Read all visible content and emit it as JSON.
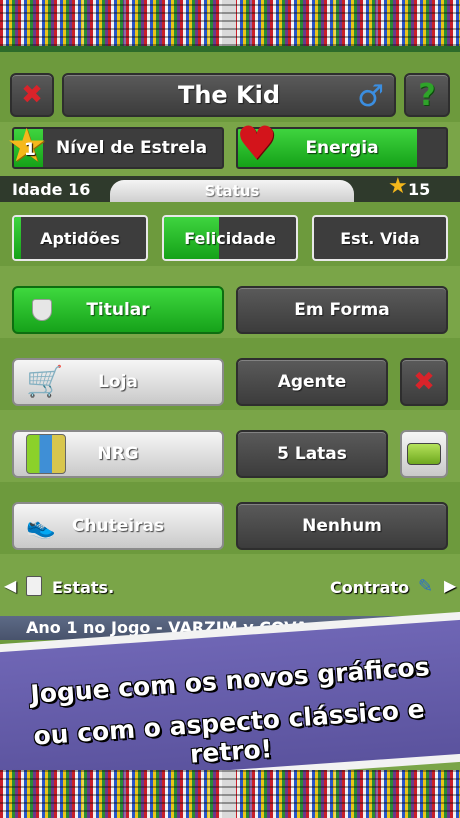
{
  "header": {
    "player_name": "The Kid",
    "close_icon": "close-x-icon",
    "gender_icon": "male-symbol-icon",
    "help_label": "?"
  },
  "bars": {
    "star_level": "1",
    "star_label": "Nível de Estrela",
    "star_fill": 0.14,
    "energy_label": "Energia",
    "energy_fill": 0.86
  },
  "status": {
    "age_label": "Idade 16",
    "tab_label": "Status",
    "coins": "15"
  },
  "attributes": {
    "aptidoes_label": "Aptidões",
    "aptidoes_fill": 0.05,
    "felicidade_label": "Felicidade",
    "felicidade_fill": 0.42,
    "estvida_label": "Est. Vida",
    "estvida_fill": 0.0
  },
  "actions": {
    "titular": "Titular",
    "em_forma": "Em Forma",
    "loja": "Loja",
    "agente": "Agente",
    "nrg": "NRG",
    "latas": "5 Latas",
    "chuteiras": "Chuteiras",
    "nenhum": "Nenhum"
  },
  "nav": {
    "stats": "Estats.",
    "contract": "Contrato",
    "ticker": "Ano 1    no Jogo - VARZIM v COVA"
  },
  "promo": {
    "line1": "Jogue com os novos gráficos",
    "line2": "ou com o aspecto clássico e retro!"
  },
  "colors": {
    "pitch": "#7aa548",
    "active_green": "#16a21a",
    "dark_button": "#3c3c3c",
    "banner": "#6f66b5",
    "close_red": "#d9232a",
    "help_green": "#2fa32a"
  }
}
